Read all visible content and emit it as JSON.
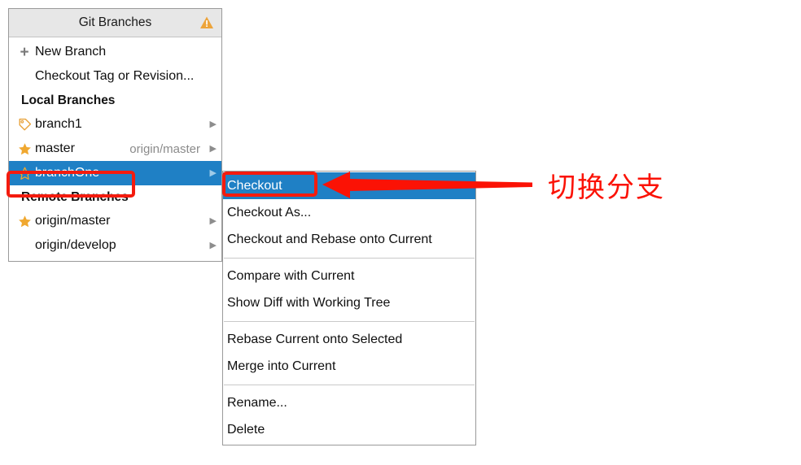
{
  "panel": {
    "title": "Git Branches",
    "warning_icon": "warning-triangle-icon",
    "accent_blue": "#1f80c5",
    "actions": [
      {
        "icon": "plus-icon",
        "label": "New Branch"
      },
      {
        "icon": "none",
        "label": "Checkout Tag or Revision..."
      }
    ],
    "groups": [
      {
        "heading": "Local Branches",
        "items": [
          {
            "icon": "tag-icon",
            "label": "branch1",
            "tracking": "",
            "chevron": "▶",
            "selected": false
          },
          {
            "icon": "star-filled-icon",
            "label": "master",
            "tracking": "origin/master",
            "chevron": "▶",
            "selected": false
          },
          {
            "icon": "star-outline-icon",
            "label": "branchOne",
            "tracking": "",
            "chevron": "▶",
            "selected": true
          }
        ]
      },
      {
        "heading": "Remote Branches",
        "items": [
          {
            "icon": "star-filled-icon",
            "label": "origin/master",
            "tracking": "",
            "chevron": "▶",
            "selected": false
          },
          {
            "icon": "none",
            "label": "origin/develop",
            "tracking": "",
            "chevron": "▶",
            "selected": false
          }
        ]
      }
    ]
  },
  "context_menu": {
    "groups": [
      {
        "items": [
          {
            "label": "Checkout",
            "highlighted": true
          },
          {
            "label": "Checkout As...",
            "highlighted": false
          },
          {
            "label": "Checkout and Rebase onto Current",
            "highlighted": false
          }
        ]
      },
      {
        "items": [
          {
            "label": "Compare with Current",
            "highlighted": false
          },
          {
            "label": "Show Diff with Working Tree",
            "highlighted": false
          }
        ]
      },
      {
        "items": [
          {
            "label": "Rebase Current onto Selected",
            "highlighted": false
          },
          {
            "label": "Merge into Current",
            "highlighted": false
          }
        ]
      },
      {
        "items": [
          {
            "label": "Rename...",
            "highlighted": false
          },
          {
            "label": "Delete",
            "highlighted": false
          }
        ]
      }
    ]
  },
  "annotation": {
    "text": "切换分支",
    "color": "#fb1205",
    "arrow_icon": "left-arrow-icon",
    "highlight_boxes": [
      "branchOne row",
      "Checkout menu item"
    ]
  }
}
